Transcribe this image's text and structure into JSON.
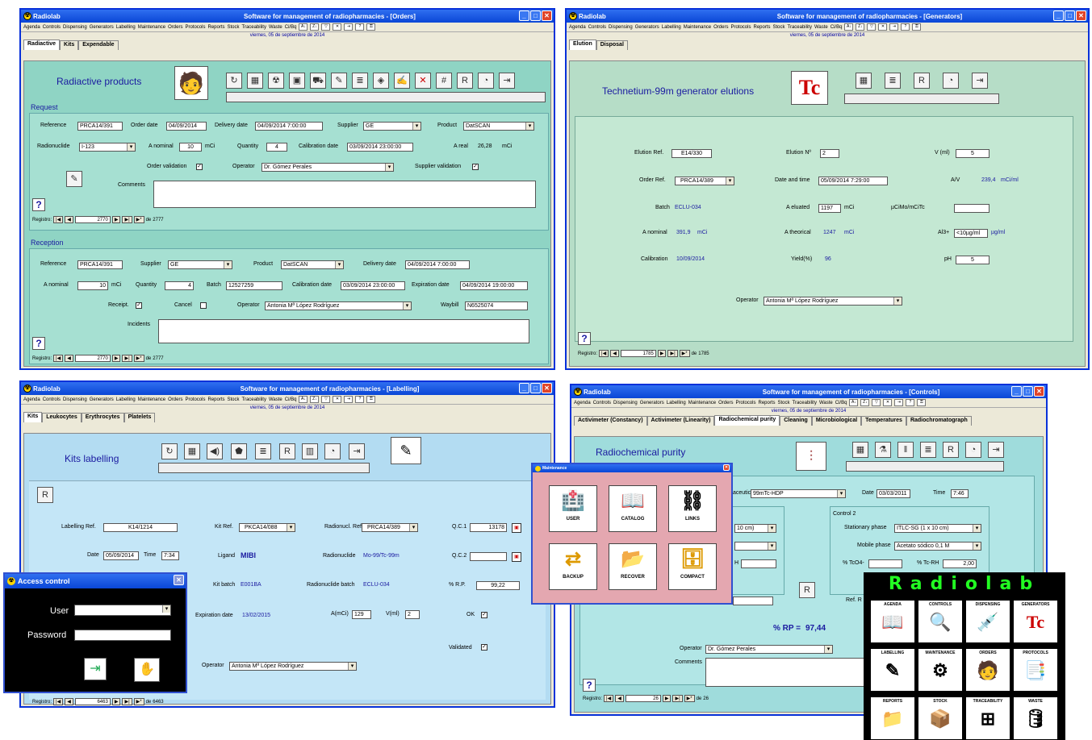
{
  "app_name": "Radiolab",
  "menu_items": [
    "Agenda",
    "Controls",
    "Dispensing",
    "Generators",
    "Labelling",
    "Maintenance",
    "Orders",
    "Protocols",
    "Reports",
    "Stock",
    "Traceability",
    "Waste",
    "Ci/Bq"
  ],
  "date": "viernes, 05 de septiembre de 2014",
  "orders": {
    "title": "Software for management of radiopharmacies - [Orders]",
    "tabs": [
      "Radiactive",
      "Kits",
      "Expendable"
    ],
    "heading": "Radiactive products",
    "request_label": "Request",
    "reference_label": "Reference",
    "reference": "PRCA14/391",
    "order_date_label": "Order date",
    "order_date": "04/09/2014",
    "delivery_date_label": "Delivery date",
    "delivery_date": "04/09/2014 7:00:00",
    "supplier_label": "Supplier",
    "supplier": "GE",
    "product_label": "Product",
    "product": "DatSCAN",
    "radionuclide_label": "Radionuclide",
    "radionuclide": "I-123",
    "a_nominal_label": "A nominal",
    "a_nominal": "10",
    "mci": "mCi",
    "quantity_label": "Quantity",
    "quantity": "4",
    "calibration_label": "Calibration date",
    "calibration_date": "03/09/2014 23:00:00",
    "a_real_label": "A real",
    "a_real": "26,28",
    "order_validation_label": "Order validation",
    "operator_label": "Operator",
    "operator": "Dr. Gómez Perales",
    "supplier_validation_label": "Supplier validation",
    "comments_label": "Comments",
    "registro_label": "Registro:",
    "record": "2770",
    "de": "de",
    "total": "2777",
    "reception_label": "Reception",
    "r_reference": "PRCA14/391",
    "r_supplier": "GE",
    "r_product": "DatSCAN",
    "r_delivery": "04/09/2014 7:00:00",
    "r_a_nominal": "10",
    "r_quantity": "4",
    "batch_label": "Batch",
    "batch": "12527259",
    "r_calibration": "03/09/2014 23:00:00",
    "expiration_label": "Expiration date",
    "expiration": "04/09/2014 19:00:00",
    "receipt_label": "Receipt.",
    "cancel_label": "Cancel",
    "r_operator": "Antonia Mª López Rodríguez",
    "waybill_label": "Waybill",
    "waybill": "N6525074",
    "incidents_label": "Incidents",
    "r_record": "2770",
    "r_total": "2777"
  },
  "generators": {
    "title": "Software for management of radiopharmacies - [Generators]",
    "tabs": [
      "Elution",
      "Disposal"
    ],
    "heading": "Technetium-99m generator elutions",
    "tc": "Tc",
    "elution_ref_label": "Elution Ref.",
    "elution_ref": "E14/330",
    "elution_no_label": "Elution Nº",
    "elution_no": "2",
    "v_label": "V (ml)",
    "v": "5",
    "order_ref_label": "Order Ref.",
    "order_ref": "PRCA14/389",
    "datetime_label": "Date and time",
    "datetime": "05/09/2014 7:29:00",
    "av_label": "A/V",
    "av": "239,4",
    "av_unit": "mCi/ml",
    "batch_label": "Batch",
    "batch": "ECLU-034",
    "eluted_label": "A eluated",
    "eluted": "1197",
    "mci": "mCi",
    "ucimo_label": "µCiMo/mCiTc",
    "a_nominal_label": "A nominal",
    "a_nominal": "391,9",
    "theoric_label": "A theorical",
    "theoric": "1247",
    "al3_label": "Al3+",
    "al3": "<10µg/ml",
    "al3_unit": "µg/ml",
    "calibration_label": "Calibration",
    "calibration": "10/09/2014",
    "yield_label": "Yield(%)",
    "yield": "96",
    "ph_label": "pH",
    "ph": "5",
    "operator_label": "Operator",
    "operator": "Antonia Mª López Rodríguez",
    "registro_label": "Registro:",
    "record": "1785",
    "de": "de",
    "total": "1785"
  },
  "labelling": {
    "title": "Software for management of radiopharmacies - [Labelling]",
    "tabs": [
      "Kits",
      "Leukocytes",
      "Erythrocytes",
      "Platelets"
    ],
    "heading": "Kits labelling",
    "labelling_ref_label": "Labelling Ref.",
    "labelling_ref": "K14/1214",
    "kit_ref_label": "Kit Ref.",
    "kit_ref": "PKCA14/088",
    "radionucl_ref_label": "Radionucl. Ref.",
    "radionucl_ref": "PRCA14/389",
    "qc1_label": "Q.C.1",
    "qc1": "13178",
    "date_label": "Date",
    "date": "05/09/2014",
    "time_label": "Time",
    "time": "7:34",
    "ligand_label": "Ligand",
    "ligand": "MIBI",
    "radionuclide_label": "Radionuclide",
    "radionuclide": "Mo-99/Tc-99m",
    "qc2_label": "Q.C.2",
    "kit_batch_label": "Kit batch",
    "kit_batch": "E001BA",
    "rn_batch_label": "Radionuclide batch",
    "rn_batch": "ECLU-034",
    "rp_label": "% R.P.",
    "rp": "99,22",
    "expiration_label": "Expiration date",
    "expiration": "13/02/2015",
    "amci_label": "A(mCi)",
    "amci": "129",
    "vml_label": "V(ml)",
    "vml": "2",
    "ok_label": "OK",
    "validated_label": "Validated",
    "operator_label": "Operator",
    "operator": "Antonia Mª López Rodríguez",
    "registro_label": "Registro:",
    "record": "6463",
    "de": "de",
    "total": "6463"
  },
  "access": {
    "title": "Access control",
    "user_label": "User",
    "password_label": "Password"
  },
  "controls": {
    "title": "Software for management of radiopharmacies - [Controls]",
    "tabs": [
      "Activimeter (Constancy)",
      "Activimeter (Linearity)",
      "Radiochemical purity",
      "Cleaning",
      "Microbiological",
      "Temperatures",
      "Radiochromatograph"
    ],
    "heading": "Radiochemical purity",
    "radiopharm_partial": "aceutical",
    "radiopharm": "99mTc-HDP",
    "date_label": "Date",
    "date": "03/03/2011",
    "time_label": "Time",
    "time": "7:46",
    "control2_label": "Control 2",
    "c1_phase_partial": "10 cm)",
    "stationary_label": "Stationary phase",
    "stationary": "ITLC-SG (1 x 10 cm)",
    "mobile_label": "Mobile phase",
    "mobile": "Acetato sódico 0,1 M",
    "tco4_label": "% TcO4-",
    "tcrh_label": "% Tc-RH",
    "tcrh": "2,00",
    "h_partial": "H",
    "ref_partial": "Ref. R",
    "rp_label": "% RP =",
    "rp": "97,44",
    "operator_label": "Operator",
    "operator": "Dr. Gómez Perales",
    "comments_label": "Comments",
    "registro_label": "Registro:",
    "record": "26",
    "de": "de",
    "total": "26"
  },
  "maintenance": {
    "title": "Maintenance",
    "tiles": [
      "USER",
      "CATALOG",
      "LINKS",
      "BACKUP",
      "RECOVER",
      "COMPACT"
    ]
  },
  "radiolab_menu": {
    "logo": "Radiolab",
    "tiles": [
      "AGENDA",
      "CONTROLS",
      "DISPENSING",
      "GENERATORS",
      "LABELLING",
      "MAINTENANCE",
      "ORDERS",
      "PROTOCOLS",
      "REPORTS",
      "STOCK",
      "TRACEABILITY",
      "WASTE"
    ]
  }
}
